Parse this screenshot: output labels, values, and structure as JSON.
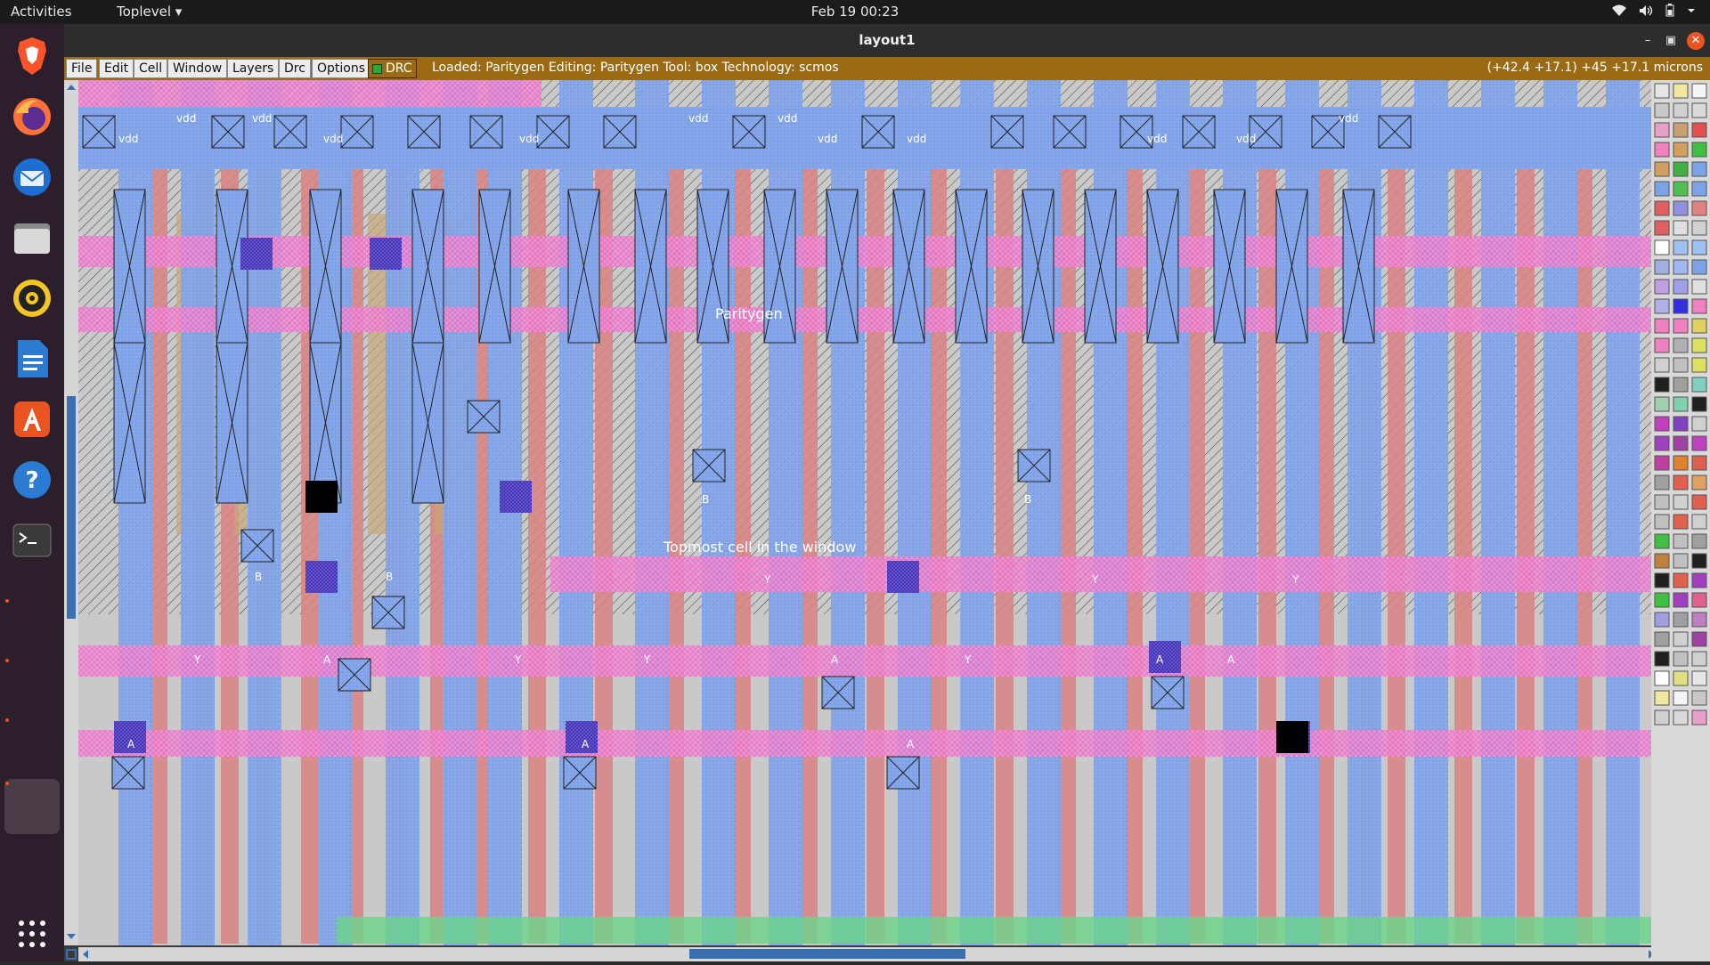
{
  "topbar": {
    "activities": "Activities",
    "app_menu": "Toplevel ▾",
    "clock": "Feb 19  00:23"
  },
  "dock": {
    "items": [
      "brave-browser",
      "firefox",
      "thunderbird",
      "files",
      "rhythmbox",
      "libreoffice-writer",
      "app-center",
      "help",
      "terminal",
      "show-apps"
    ]
  },
  "window": {
    "title": "layout1",
    "menus": [
      "File",
      "Edit",
      "Cell",
      "Window",
      "Layers",
      "Drc",
      "Options"
    ],
    "drc_label": "DRC",
    "status": "Loaded: Paritygen Editing: Paritygen Tool: box  Technology: scmos",
    "coords": "(+42.4 +17.1) +45 +17.1 microns"
  },
  "canvas": {
    "cell_label": "Paritygen",
    "topcell_label": "Topmost cell in the window",
    "labels": {
      "vdd": "vdd",
      "A": "A",
      "B": "B",
      "Y": "Y"
    }
  },
  "colors": {
    "metal1": "#7ea2e8",
    "poly": "#d98282",
    "ndiff": "#f08cd8",
    "pdiff": "#c8a070",
    "background": "#c9c9c9",
    "nwell_hatch": "#2a2a2a",
    "menubar": "#9a6a14"
  }
}
